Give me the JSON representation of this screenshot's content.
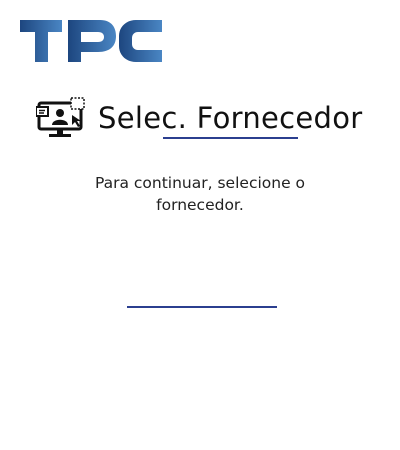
{
  "header": {
    "logo_text": "TPC",
    "logo_color": "#2a4f93"
  },
  "main": {
    "title": "Selec. Fornecedor",
    "title_icon": "provider-select-monitor-icon",
    "instruction": "Para continuar, selecione o fornecedor.",
    "provider_select": {
      "value": ""
    }
  },
  "colors": {
    "accent": "#2b3f8f",
    "logo_gradient_start": "#1f4a8a",
    "logo_gradient_end": "#4a86c4"
  }
}
